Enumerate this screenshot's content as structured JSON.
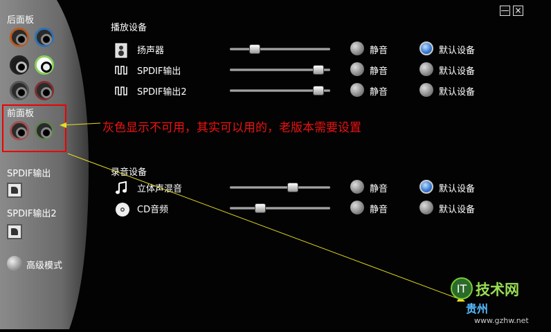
{
  "window": {
    "minimize_label": "—",
    "close_label": "×"
  },
  "sidebar": {
    "rear_panel_label": "后面板",
    "front_panel_label": "前面板",
    "spdif_out_label": "SPDIF输出",
    "spdif_out2_label": "SPDIF输出2",
    "advanced_mode_label": "高级模式"
  },
  "playback": {
    "title": "播放设备",
    "devices": [
      {
        "name": "扬声器",
        "icon": "speaker-icon",
        "volume": 0.22,
        "mute_label": "静音",
        "muted": false,
        "default_label": "默认设备",
        "is_default": true
      },
      {
        "name": "SPDIF输出",
        "icon": "spdif-wave-icon",
        "volume": 0.93,
        "mute_label": "静音",
        "muted": false,
        "default_label": "默认设备",
        "is_default": false
      },
      {
        "name": "SPDIF输出2",
        "icon": "spdif-wave-icon",
        "volume": 0.93,
        "mute_label": "静音",
        "muted": false,
        "default_label": "默认设备",
        "is_default": false
      }
    ]
  },
  "recording": {
    "title": "录音设备",
    "devices": [
      {
        "name": "立体声混音",
        "icon": "music-note-icon",
        "volume": 0.64,
        "mute_label": "静音",
        "muted": false,
        "default_label": "默认设备",
        "is_default": true
      },
      {
        "name": "CD音频",
        "icon": "cd-icon",
        "volume": 0.28,
        "mute_label": "静音",
        "muted": false,
        "default_label": "默认设备",
        "is_default": false
      }
    ]
  },
  "annotation": {
    "text": "灰色显示不可用，其实可以用的，老版本需要设置",
    "color": "#e11111"
  },
  "watermark": {
    "brand": "技术网",
    "site_cn": "贵州",
    "url": "www.gzhw.net"
  }
}
